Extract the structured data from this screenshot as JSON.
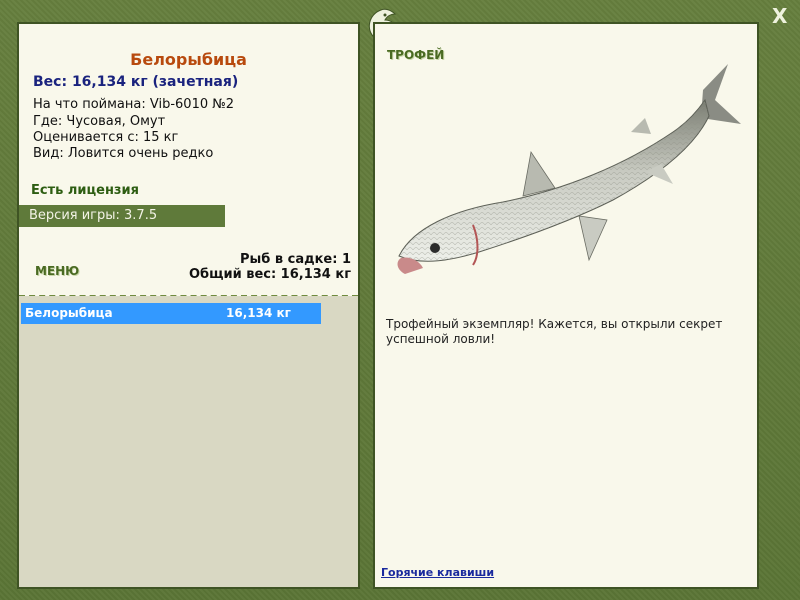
{
  "header": {
    "close_label": "X",
    "logo_icon": "fish-logo-icon"
  },
  "fish": {
    "name": "Белорыбица",
    "weight_text": "Вес: 16,134 кг (зачетная)",
    "caught_on": "На что поймана: Vib-6010 №2",
    "location": "Где: Чусовая, Омут",
    "valued_from": "Оценивается с: 15 кг",
    "rarity": "Вид: Ловится очень редко"
  },
  "license": "Есть лицензия",
  "version": "Версия игры: 3.7.5",
  "menu": {
    "title": "МЕНЮ"
  },
  "stats": {
    "fish_count": "Рыб в садке: 1",
    "total_weight": "Общий вес: 16,134 кг"
  },
  "catch_list": [
    {
      "name": "Белорыбица",
      "weight": "16,134 кг"
    }
  ],
  "trophy": {
    "title": "ТРОФЕЙ",
    "description": "Трофейный экземпляр! Кажется, вы открыли секрет успешной ловли!",
    "image": "belorybitsa-fish-image"
  },
  "hotkeys_link": "Горячие клавиши",
  "colors": {
    "frame": "#5f7a3a",
    "panel": "#f9f8eb",
    "title": "#b84a0e",
    "weight": "#1a237e",
    "selection": "#3399ff"
  }
}
